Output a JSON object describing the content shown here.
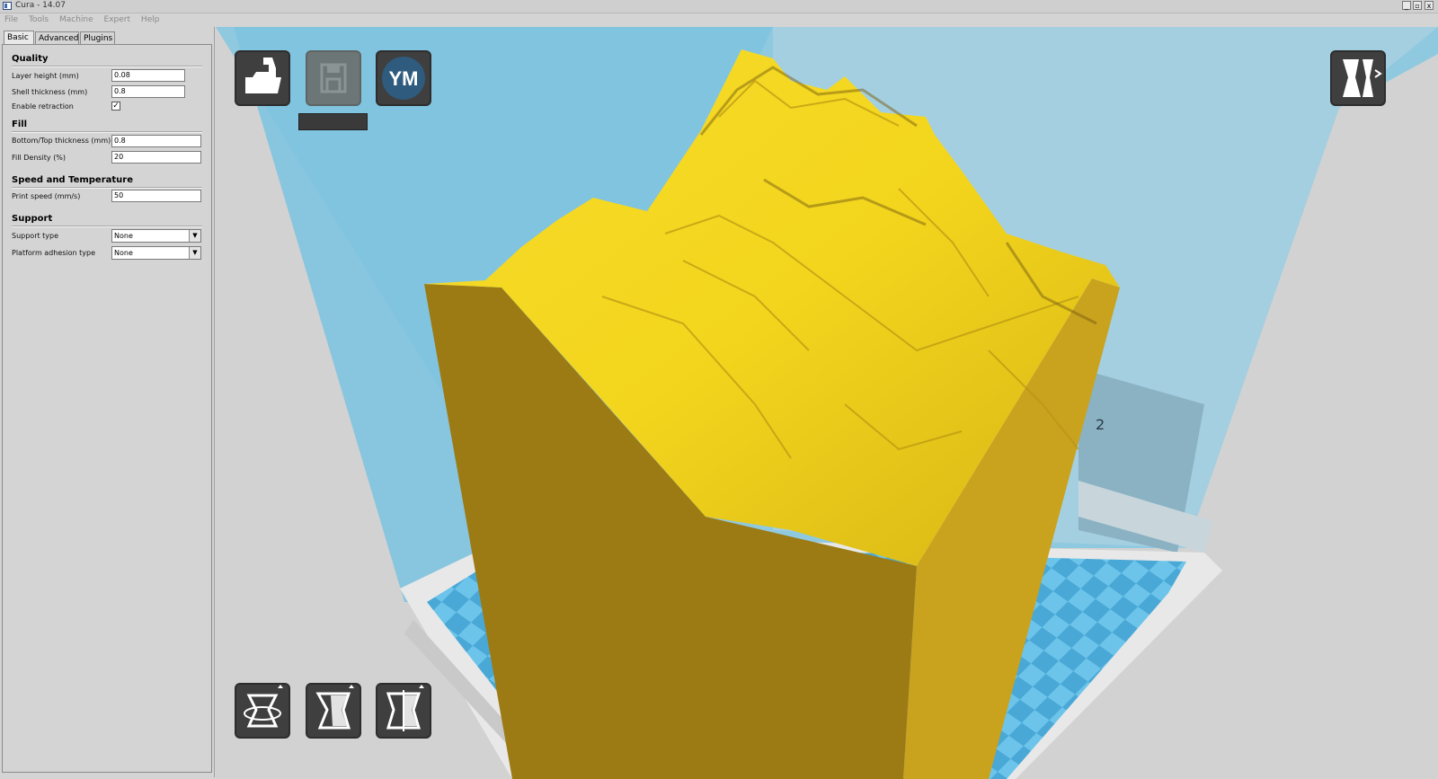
{
  "window": {
    "title": "Cura - 14.07",
    "controls": [
      "_",
      "▫",
      "x"
    ]
  },
  "menu": [
    "File",
    "Tools",
    "Machine",
    "Expert",
    "Help"
  ],
  "tabs": [
    "Basic",
    "Advanced",
    "Plugins"
  ],
  "active_tab": "Basic",
  "sections": {
    "quality": {
      "title": "Quality",
      "layer_height": {
        "label": "Layer height (mm)",
        "value": "0.08"
      },
      "shell_thickness": {
        "label": "Shell thickness (mm)",
        "value": "0.8"
      },
      "enable_retraction": {
        "label": "Enable retraction",
        "checked": true,
        "mark": "✓"
      }
    },
    "fill": {
      "title": "Fill",
      "bottom_top": {
        "label": "Bottom/Top thickness (mm)",
        "value": "0.8"
      },
      "density": {
        "label": "Fill Density (%)",
        "value": "20"
      }
    },
    "speed": {
      "title": "Speed and Temperature",
      "print_speed": {
        "label": "Print speed (mm/s)",
        "value": "50"
      }
    },
    "support": {
      "title": "Support",
      "support_type": {
        "label": "Support type",
        "value": "None"
      },
      "adhesion": {
        "label": "Platform adhesion type",
        "value": "None"
      }
    }
  },
  "toolbar": {
    "youmagine_label": "YM"
  },
  "viewport": {
    "axis_label": "2",
    "colors": {
      "volume": "#7ec4e0",
      "model_top": "#f2d21a",
      "model_side": "#9c7a14",
      "model_right": "#c9a21e",
      "bed": "#6cc4ea"
    }
  }
}
